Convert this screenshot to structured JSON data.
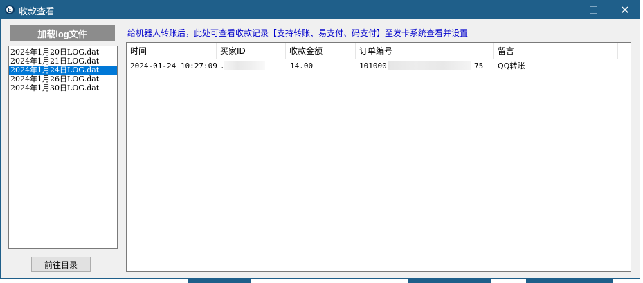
{
  "window": {
    "title": "收款查看",
    "icon": "app-logo-icon",
    "icon_glyph": "E",
    "controls": {
      "minimize_icon": "minimize-icon",
      "maximize_icon": "maximize-icon",
      "close": "✕"
    },
    "accent": "#1f5f8a"
  },
  "sidebar": {
    "load_button": "加载log文件",
    "files": [
      "2024年1月20日LOG.dat",
      "2024年1月21日LOG.dat",
      "2024年1月24日LOG.dat",
      "2024年1月26日LOG.dat",
      "2024年1月30日LOG.dat"
    ],
    "selected_index": 2,
    "nav_button": "前往目录"
  },
  "main": {
    "info_text": "给机器人转账后，此处可查看收款记录【支持转账、易支付、码支付】至发卡系统查看并设置",
    "table": {
      "columns": [
        "时间",
        "买家ID",
        "收款金额",
        "订单编号",
        "留言"
      ],
      "rows": [
        {
          "time": "2024-01-24 10:27:09",
          "buyer_id": ".",
          "amount": "14.00",
          "order_prefix": "101000",
          "order_suffix": "75",
          "message": "QQ转账"
        }
      ]
    }
  }
}
